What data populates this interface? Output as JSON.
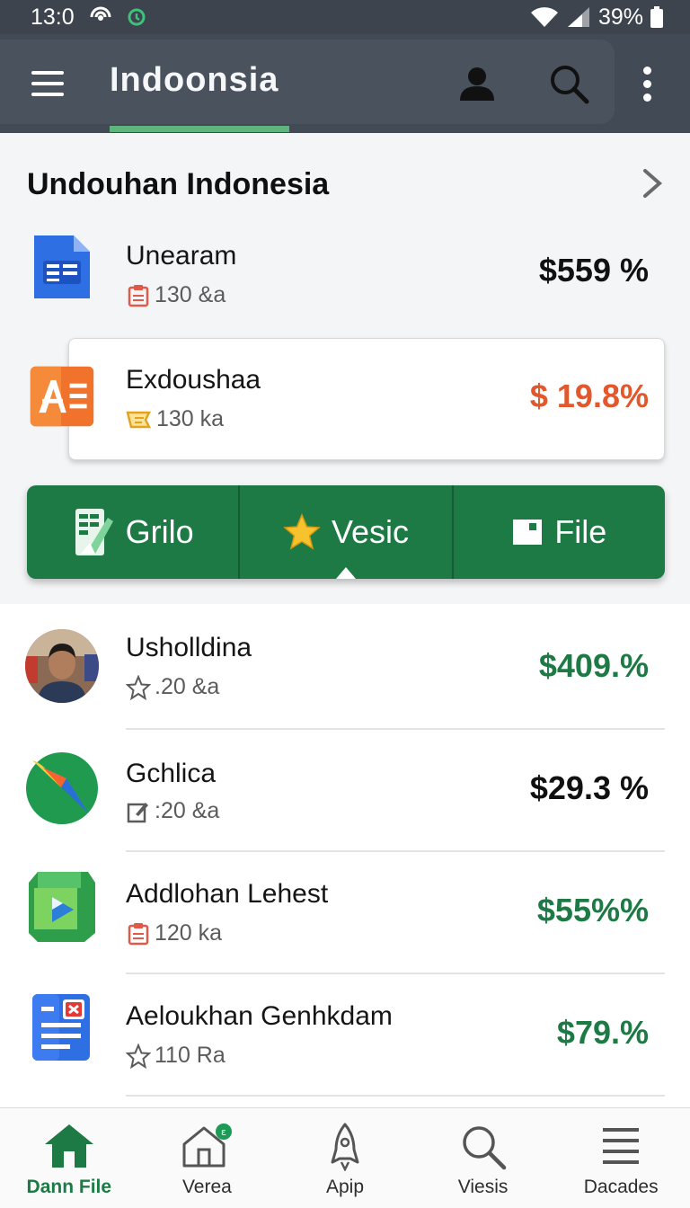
{
  "status_bar": {
    "time": "13:0",
    "battery": "39%"
  },
  "app_bar": {
    "title": "Indoonsia"
  },
  "section": {
    "title": "Undouhan Indonesia"
  },
  "items": [
    {
      "name": "Unearam",
      "meta": "130 &a",
      "value": "$559 %",
      "value_color": "#111111",
      "icon": "docs-icon"
    },
    {
      "name": "Exdoushaa",
      "meta": "130 ka",
      "value": "$ 19.8%",
      "value_color": "#e2582c",
      "icon": "slides-icon"
    },
    {
      "name": "Usholldina",
      "meta": ".20 &a",
      "value": "$409.%",
      "value_color": "#1d7a45",
      "icon": "avatar"
    },
    {
      "name": "Gchlica",
      "meta": ":20 &a",
      "value": "$29.3 %",
      "value_color": "#111111",
      "icon": "compass-icon"
    },
    {
      "name": "Addlohan Lehest",
      "meta": "120 ka",
      "value": "$55%%",
      "value_color": "#1d7a45",
      "icon": "play-icon"
    },
    {
      "name": "Aeloukhan Genhkdam",
      "meta": "110 Ra",
      "value": "$79.%",
      "value_color": "#1d7a45",
      "icon": "doc-error-icon"
    }
  ],
  "segments": [
    {
      "label": "Grilo",
      "icon": "sheets-icon"
    },
    {
      "label": "Vesic",
      "icon": "star-icon",
      "active": true
    },
    {
      "label": "File",
      "icon": "file-icon"
    }
  ],
  "bottom_nav": [
    {
      "label": "Dann File",
      "icon": "home-icon",
      "active": true
    },
    {
      "label": "Verea",
      "icon": "house-outline-icon"
    },
    {
      "label": "Apip",
      "icon": "rocket-icon"
    },
    {
      "label": "Viesis",
      "icon": "search-icon"
    },
    {
      "label": "Dacades",
      "icon": "menu-icon"
    }
  ],
  "colors": {
    "accent": "#1d7a45",
    "app_bar": "#424a55",
    "underline": "#5fb37c"
  }
}
